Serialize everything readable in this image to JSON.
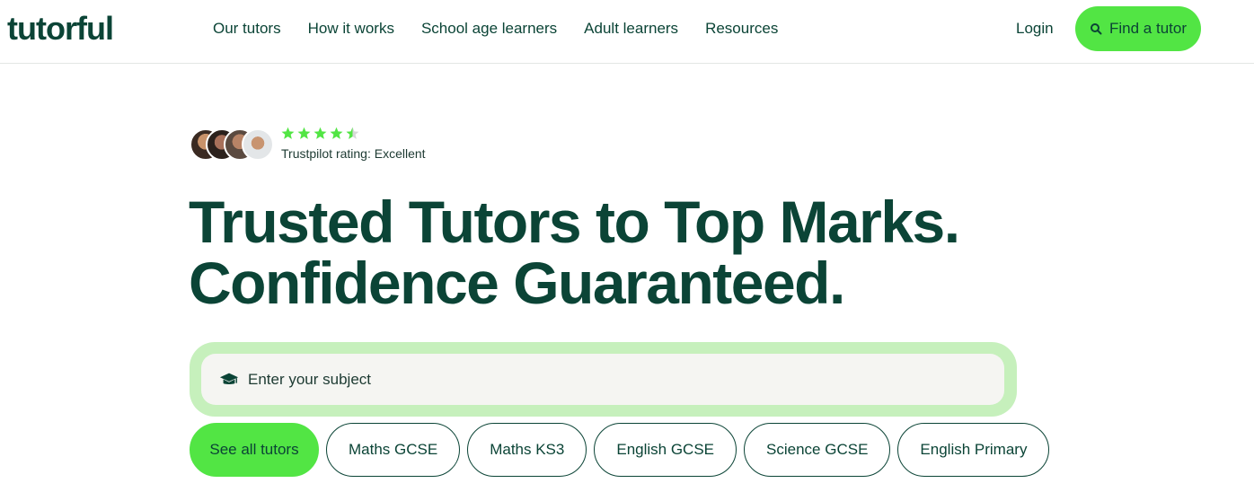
{
  "brand": {
    "logo_text": "tutorful",
    "accent": "#52e544",
    "primary": "#0b4436"
  },
  "nav": {
    "items": [
      {
        "label": "Our tutors"
      },
      {
        "label": "How it works"
      },
      {
        "label": "School age learners"
      },
      {
        "label": "Adult learners"
      },
      {
        "label": "Resources"
      }
    ],
    "login_label": "Login",
    "find_tutor": {
      "label": "Find a tutor",
      "icon": "search-icon"
    }
  },
  "trust": {
    "rating_stars": 4.5,
    "rating_text": "Trustpilot rating: Excellent",
    "avatars": [
      "avatar-1",
      "avatar-2",
      "avatar-3",
      "avatar-4"
    ]
  },
  "hero": {
    "line1": "Trusted Tutors to Top Marks.",
    "line2": "Confidence Guaranteed."
  },
  "search": {
    "icon": "graduation-cap-icon",
    "placeholder": "Enter your subject"
  },
  "chips": [
    {
      "label": "See all tutors"
    },
    {
      "label": "Maths GCSE"
    },
    {
      "label": "Maths KS3"
    },
    {
      "label": "English GCSE"
    },
    {
      "label": "Science GCSE"
    },
    {
      "label": "English Primary"
    }
  ]
}
